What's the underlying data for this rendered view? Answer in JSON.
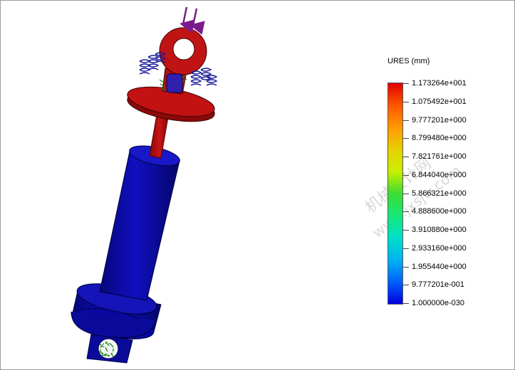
{
  "legend": {
    "title": "URES (mm)",
    "values": [
      "1.173264e+001",
      "1.075492e+001",
      "9.777201e+000",
      "8.799480e+000",
      "7.821761e+000",
      "6.844040e+000",
      "5.866321e+000",
      "4.888600e+000",
      "3.910880e+000",
      "2.933160e+000",
      "1.955440e+000",
      "9.777201e-001",
      "1.000000e-030"
    ]
  },
  "watermark": {
    "line1": "机械设计网",
    "line2": "www.jxsjw.com"
  },
  "colors": {
    "cylinder": "#0a0aa8",
    "eye_rod": "#b01010",
    "load_arrow": "#7a1a8a",
    "spring": "#1a1a9a",
    "fixture": "#1a8a1a"
  }
}
